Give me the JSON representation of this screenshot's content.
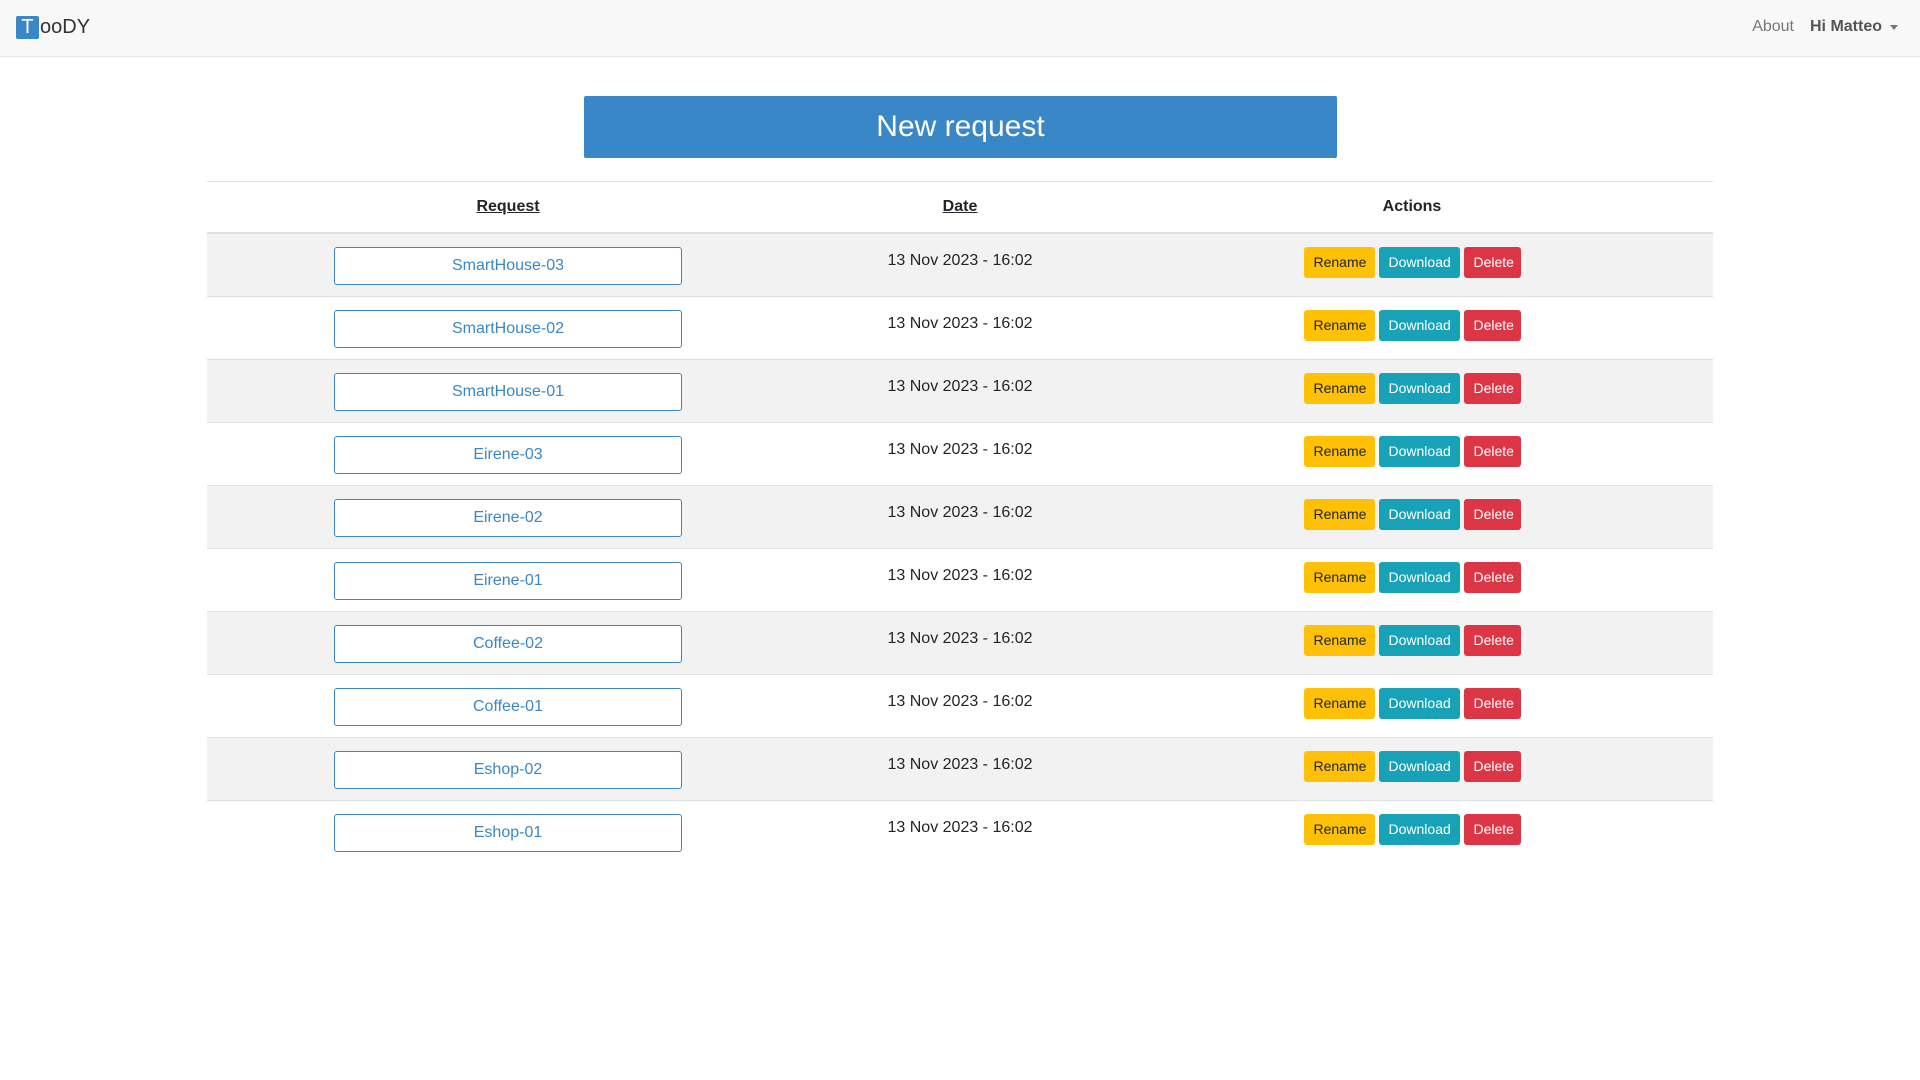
{
  "navbar": {
    "brand_logo_letter": "T",
    "brand_text": "ooDY",
    "about_label": "About",
    "user_label": "Hi Matteo"
  },
  "main": {
    "new_request_label": "New request"
  },
  "table": {
    "headers": {
      "request": "Request",
      "date": "Date",
      "actions": "Actions"
    },
    "rows": [
      {
        "name": "SmartHouse-03",
        "date": "13 Nov 2023 - 16:02",
        "rename": "Rename",
        "download": "Download",
        "delete": "Delete"
      },
      {
        "name": "SmartHouse-02",
        "date": "13 Nov 2023 - 16:02",
        "rename": "Rename",
        "download": "Download",
        "delete": "Delete"
      },
      {
        "name": "SmartHouse-01",
        "date": "13 Nov 2023 - 16:02",
        "rename": "Rename",
        "download": "Download",
        "delete": "Delete"
      },
      {
        "name": "Eirene-03",
        "date": "13 Nov 2023 - 16:02",
        "rename": "Rename",
        "download": "Download",
        "delete": "Delete"
      },
      {
        "name": "Eirene-02",
        "date": "13 Nov 2023 - 16:02",
        "rename": "Rename",
        "download": "Download",
        "delete": "Delete"
      },
      {
        "name": "Eirene-01",
        "date": "13 Nov 2023 - 16:02",
        "rename": "Rename",
        "download": "Download",
        "delete": "Delete"
      },
      {
        "name": "Coffee-02",
        "date": "13 Nov 2023 - 16:02",
        "rename": "Rename",
        "download": "Download",
        "delete": "Delete"
      },
      {
        "name": "Coffee-01",
        "date": "13 Nov 2023 - 16:02",
        "rename": "Rename",
        "download": "Download",
        "delete": "Delete"
      },
      {
        "name": "Eshop-02",
        "date": "13 Nov 2023 - 16:02",
        "rename": "Rename",
        "download": "Download",
        "delete": "Delete"
      },
      {
        "name": "Eshop-01",
        "date": "13 Nov 2023 - 16:02",
        "rename": "Rename",
        "download": "Download",
        "delete": "Delete"
      }
    ]
  },
  "colors": {
    "primary": "#3a87c7",
    "rename": "#ffc107",
    "download": "#17a2b8",
    "delete": "#dc3545"
  }
}
